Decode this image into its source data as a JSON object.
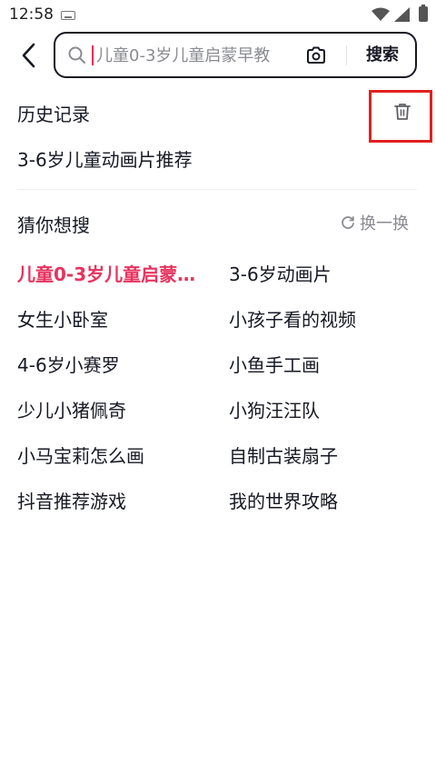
{
  "status_bar": {
    "time": "12:58"
  },
  "header": {
    "search_placeholder": "儿童0-3岁儿童启蒙早教",
    "search_button": "搜索"
  },
  "history": {
    "title": "历史记录",
    "items": [
      "3-6岁儿童动画片推荐"
    ]
  },
  "guess": {
    "title": "猜你想搜",
    "refresh_label": "换一换",
    "items": [
      "儿童0-3岁儿童启蒙…",
      "3-6岁动画片",
      "女生小卧室",
      "小孩子看的视频",
      "4-6岁小赛罗",
      "小鱼手工画",
      "少儿小猪佩奇",
      "小狗汪汪队",
      "小马宝莉怎么画",
      "自制古装扇子",
      "抖音推荐游戏",
      "我的世界攻略"
    ]
  },
  "colors": {
    "accent": "#fe2c55",
    "hot_text": "#e8335e",
    "highlight_box": "#e02020"
  }
}
